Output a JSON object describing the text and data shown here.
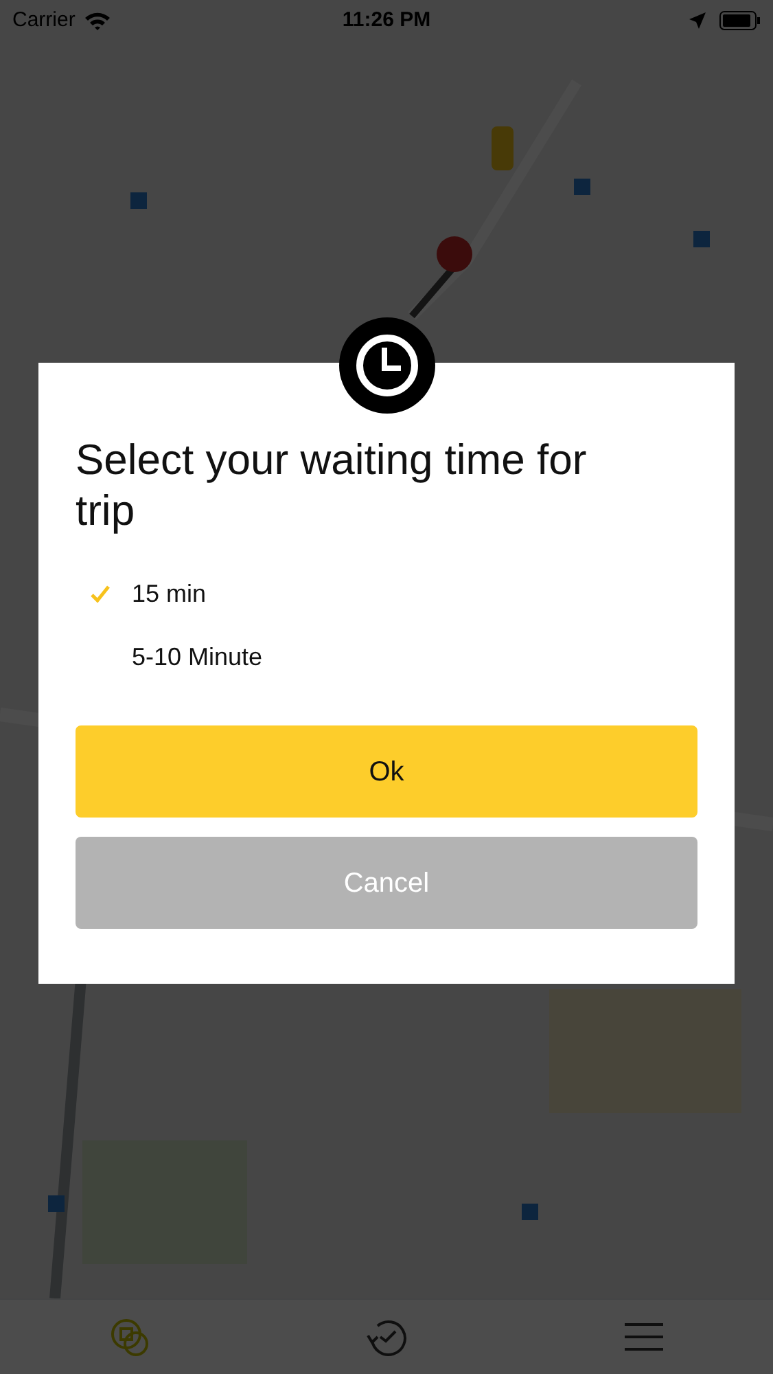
{
  "status_bar": {
    "carrier": "Carrier",
    "time": "11:26 PM"
  },
  "dialog": {
    "title": "Select your waiting time for trip",
    "options": [
      {
        "label": "15 min",
        "selected": true
      },
      {
        "label": "5-10 Minute",
        "selected": false
      }
    ],
    "buttons": [
      {
        "kind": "primary",
        "label": "Ok"
      },
      {
        "kind": "secondary",
        "label": "Cancel"
      }
    ]
  },
  "tabs": [
    {
      "kind": "cars",
      "selected": true
    },
    {
      "kind": "history",
      "selected": false
    },
    {
      "kind": "menu",
      "selected": false
    }
  ]
}
